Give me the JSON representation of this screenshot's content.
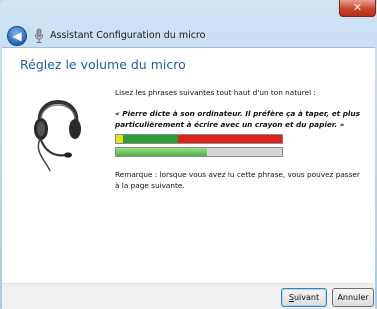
{
  "window": {
    "title": "Assistant Configuration du micro",
    "close_label": "✕"
  },
  "main": {
    "heading": "Réglez le volume du micro",
    "instruction": "Lisez les phrases suivantes tout haut d'un ton naturel :",
    "phrase": "« Pierre dicte à son ordinateur. Il préfère ça à taper, et plus particulièrement à écrire avec un crayon et du papier. »",
    "note": "Remarque : lorsque vous avez lu cette phrase, vous pouvez passer à la page suivante.",
    "input_level": 0.55
  },
  "buttons": {
    "next_underlined": "S",
    "next_rest": "uivant",
    "cancel": "Annuler"
  },
  "colors": {
    "heading": "#1f5fa6",
    "meter_yellow": "#e3e31a",
    "meter_green": "#2c9e36",
    "meter_red": "#e0201c",
    "level_fill": "#4bb43c"
  }
}
